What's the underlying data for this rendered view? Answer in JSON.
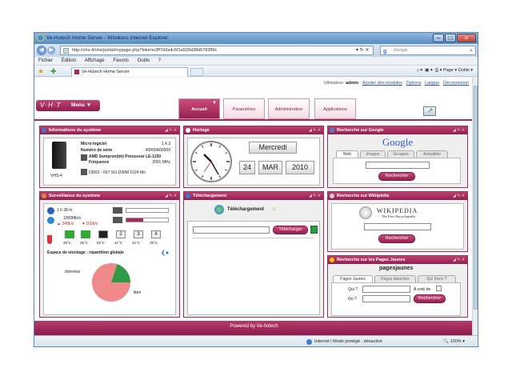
{
  "window": {
    "title": "Ve-Hotech Home Server - Windows Internet Explorer",
    "url": "http://vhs-4/vhs/portal/mypage.php?tokenn3ff7d2a4c5f1a539d38d5783f5fc",
    "search_placeholder": "Google",
    "menu": [
      "Fichier",
      "Édition",
      "Affichage",
      "Favoris",
      "Outils",
      "?"
    ],
    "tab_title": "Ve-Hotech Home Server",
    "cmd_page": "Page",
    "cmd_tools": "Outils"
  },
  "portal": {
    "user_label": "Utilisateur:",
    "user_name": "admin",
    "links": [
      "Ajouter des modules",
      "Options",
      "Langue",
      "Déconnexion"
    ],
    "menu_label": "Menu",
    "nav_tabs": [
      "Accueil",
      "Paramètres",
      "Administration",
      "Applications"
    ],
    "footer": "Powered by Ve-hotech"
  },
  "sysinfo": {
    "title": "Informations du système",
    "device": "VHS-4",
    "software_label": "Micro-logiciel",
    "software_value": "1.4.3",
    "serial_label": "Numéro de série",
    "serial_value": "40000A00009",
    "cpu_label": "AMD Sempron(tm) Processor LE-1150",
    "freq_label": "Fréquence",
    "freq_value": "2001 MHz",
    "ram": "DDR2 - 667 SO-DIMM 1024 Mo"
  },
  "clock": {
    "title": "Horloge",
    "day": "Mercredi",
    "date_day": "24",
    "date_month": "MAR",
    "date_year": "2010"
  },
  "google": {
    "title": "Recherche sur Google",
    "logo": "Google",
    "tabs": [
      "Web",
      "Images",
      "Groupes",
      "Actualités"
    ],
    "button": "Rechercher"
  },
  "monitor": {
    "title": "Surveillance du système",
    "uptime": "1 h 28 m",
    "network": "1000Mb/s",
    "rx": "240b/s",
    "tx": "160b/s",
    "temps": [
      "38°C",
      "35°C",
      "50°C",
      "41°C",
      "42°C",
      "35°C"
    ],
    "disk_numbers": [
      "1",
      "2",
      "3",
      "4"
    ],
    "storage_title": "Espace de stockage : répartition globale",
    "slice_data": "données",
    "slice_free": "libre"
  },
  "chart_data": {
    "type": "pie",
    "title": "Espace de stockage : répartition globale",
    "categories": [
      "données",
      "libre"
    ],
    "values": [
      80,
      20
    ]
  },
  "download": {
    "title": "Téléchargement",
    "heading": "Téléchargement",
    "button": "Télécharger"
  },
  "wikipedia": {
    "title": "Recherche sur Wikipédia",
    "logo": "WIKIPEDIA",
    "tagline": "The Free Encyclopedia",
    "button": "Rechercher"
  },
  "pagesjaunes": {
    "title": "Recherche sur les Pages Jaunes",
    "logo": "pagesjaunes",
    "tabs": [
      "Pages Jaunes",
      "Pages blanches",
      "Qui Donc ?"
    ],
    "who_label": "Qui ?",
    "where_label": "Où ?",
    "near_label": "À coté de",
    "button": "Rechercher"
  },
  "status": {
    "zone": "Internet | Mode protégé : désactivé",
    "zoom": "100%"
  },
  "colors": {
    "brand": "#a52a5a",
    "accent_green": "#2d9b46",
    "pie_data": "#f08a8a",
    "pie_free": "#2d9b46"
  }
}
